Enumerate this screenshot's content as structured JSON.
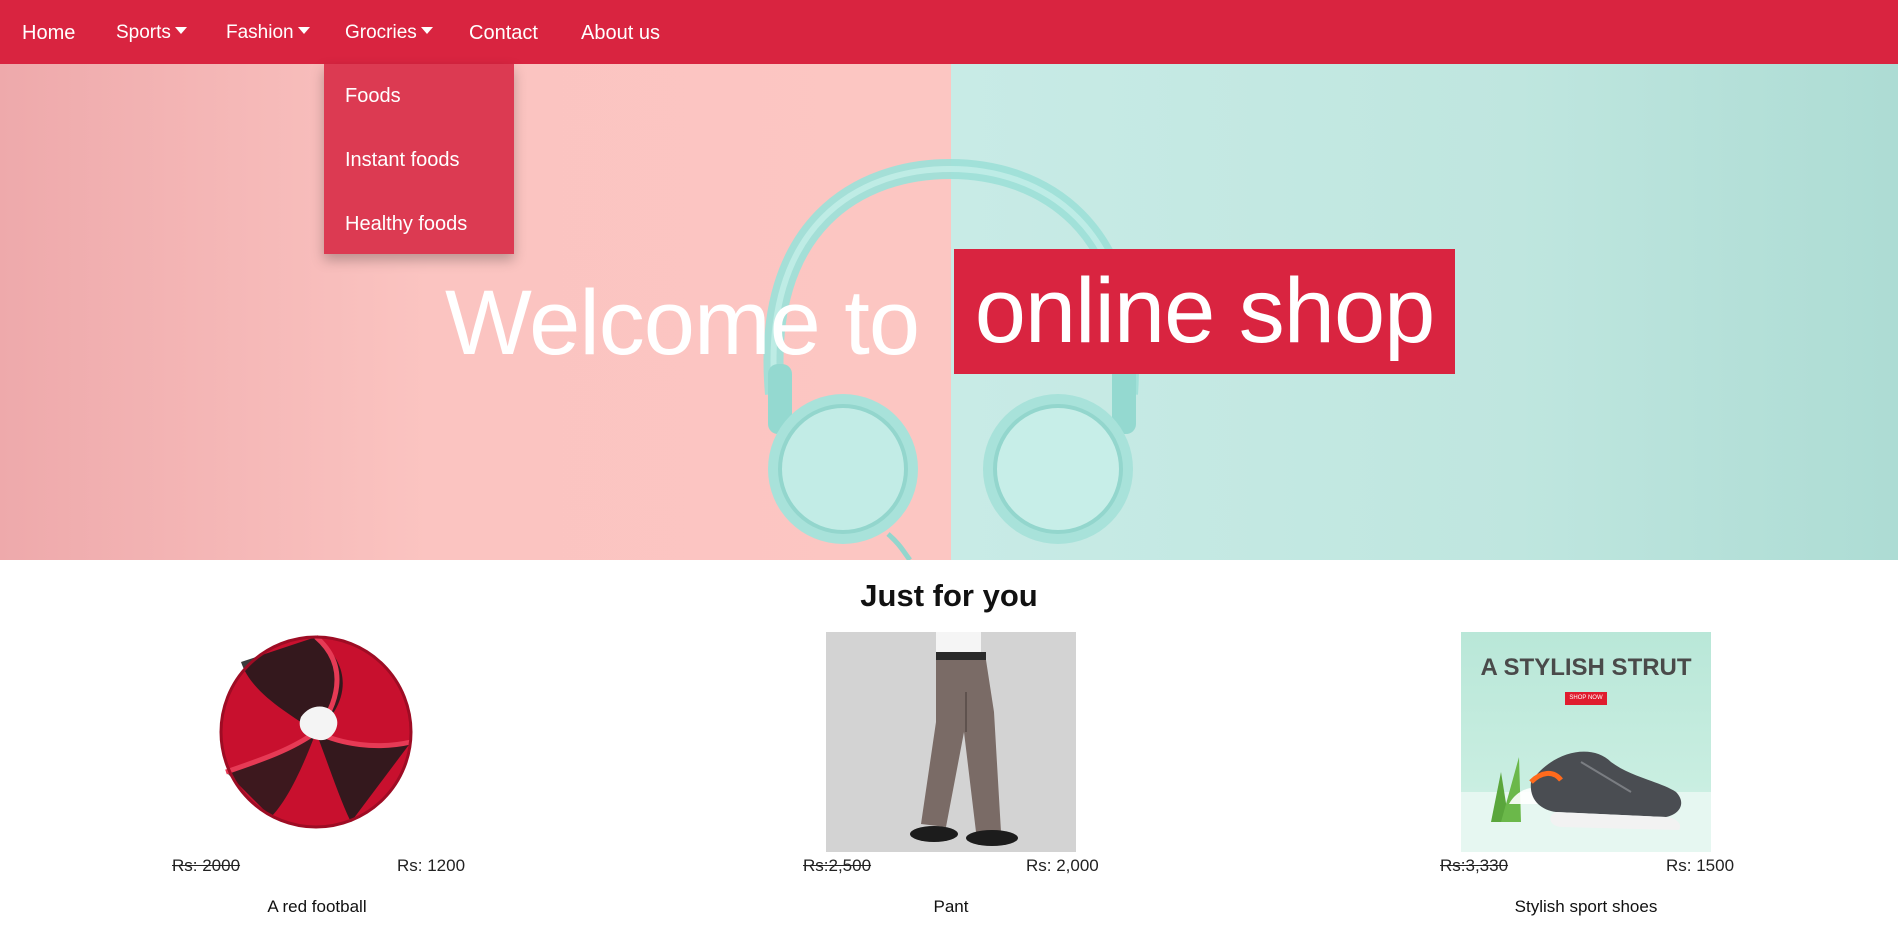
{
  "nav": {
    "home": "Home",
    "sports": "Sports",
    "fashion": "Fashion",
    "groceries": "Grocries",
    "contact": "Contact",
    "about": "About us"
  },
  "dropdown": {
    "items": [
      "Foods",
      "Instant foods",
      "Healthy foods"
    ]
  },
  "hero": {
    "title_prefix": "Welcome to",
    "title_highlight": "online shop"
  },
  "section": {
    "title": "Just for you"
  },
  "products": [
    {
      "name": "A red football",
      "old_price": "Rs: 2000",
      "new_price": "Rs: 1200",
      "icon": "football-image"
    },
    {
      "name": "Pant",
      "old_price": "Rs:2,500",
      "new_price": "Rs: 2,000",
      "icon": "pant-image"
    },
    {
      "name": "Stylish sport shoes",
      "old_price": "Rs:3,330",
      "new_price": "Rs: 1500",
      "icon": "shoe-image"
    }
  ],
  "shoe_ad": {
    "headline": "A STYLISH STRUT",
    "cta": "SHOP NOW"
  },
  "colors": {
    "brand": "#d92440",
    "dropdown_bg": "#dc3a52"
  }
}
